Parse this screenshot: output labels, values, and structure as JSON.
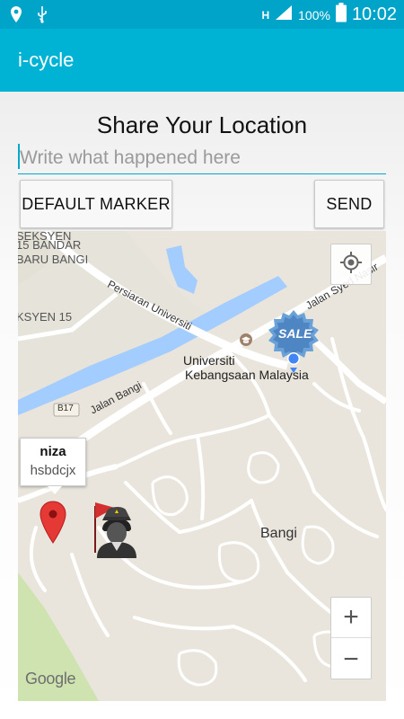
{
  "status_bar": {
    "battery_percent": "100%",
    "time": "10:02",
    "network_type": "H",
    "icons": [
      "location-icon",
      "usb-icon",
      "signal-icon",
      "battery-icon"
    ]
  },
  "app_bar": {
    "title": "i-cycle",
    "color": "#00b3d4"
  },
  "form": {
    "heading": "Share Your Location",
    "description_placeholder": "Write what happened here",
    "description_value": "",
    "default_marker_label": "DEFAULT MARKER",
    "send_label": "SEND",
    "accent_color": "#00a9cc"
  },
  "map": {
    "area_labels": {
      "seksyen15_line1": "SEKSYEN",
      "seksyen15_line2": "15 BANDAR",
      "seksyen15_line3": "BARU BANGI",
      "seksyen15_left": "KSYEN 15"
    },
    "road_labels": {
      "persiaran": "Persiaran Universiti",
      "jalan_bangi": "Jalan Bangi",
      "jalan_syed": "Jalan Syed Nasir",
      "route_badge": "B17"
    },
    "poi": {
      "university_line1": "Universiti",
      "university_line2": "Kebangsaan Malaysia"
    },
    "town": "Bangi",
    "sale_badge": "SALE",
    "info_window": {
      "title": "niza",
      "snippet": "hsbdcjx"
    },
    "zoom_in": "+",
    "zoom_out": "−",
    "attribution": "Google",
    "colors": {
      "land": "#e9e5dc",
      "road": "#ffffff",
      "water": "#a3ccff",
      "park": "#c8dfa8",
      "marker": "#e53935",
      "my_location": "#4285f4"
    }
  }
}
